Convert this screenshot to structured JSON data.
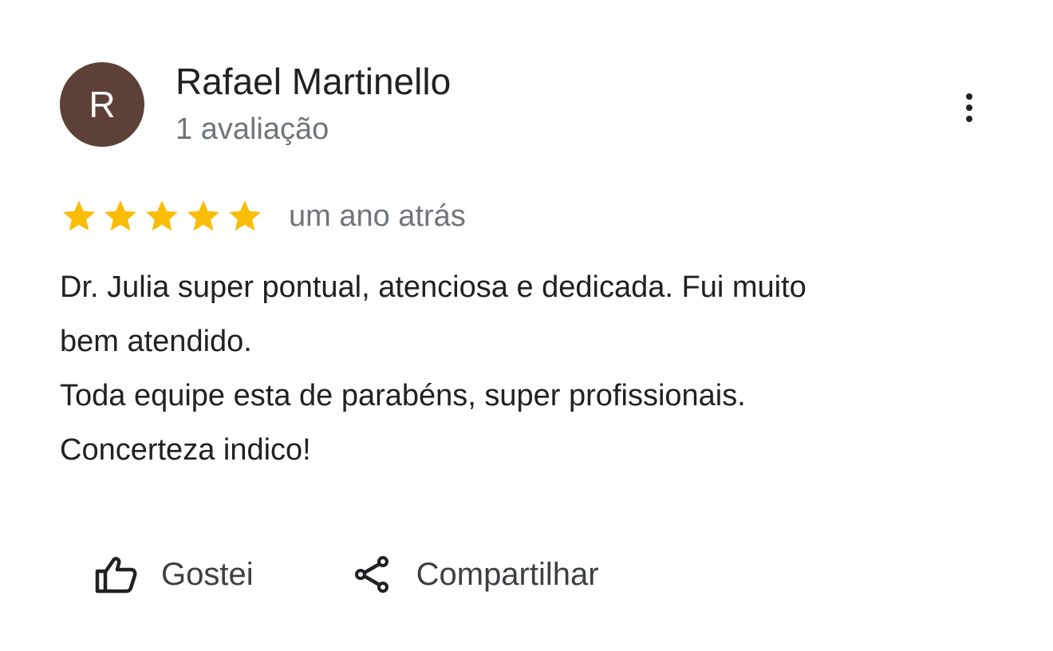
{
  "review": {
    "author": {
      "initial": "R",
      "name": "Rafael Martinello",
      "meta": "1 avaliação",
      "avatar_color": "#5d4037"
    },
    "rating": 5,
    "max_rating": 5,
    "star_color": "#fbbc04",
    "date": "um ano atrás",
    "text_lines": [
      "Dr. Julia super pontual, atenciosa e dedicada. Fui muito",
      "bem atendido.",
      "Toda equipe esta de parabéns, super profissionais.",
      "Concerteza indico!"
    ],
    "more_icon": "more-vertical-icon"
  },
  "actions": {
    "like": {
      "label": "Gostei",
      "icon": "thumbs-up-icon"
    },
    "share": {
      "label": "Compartilhar",
      "icon": "share-icon"
    }
  }
}
